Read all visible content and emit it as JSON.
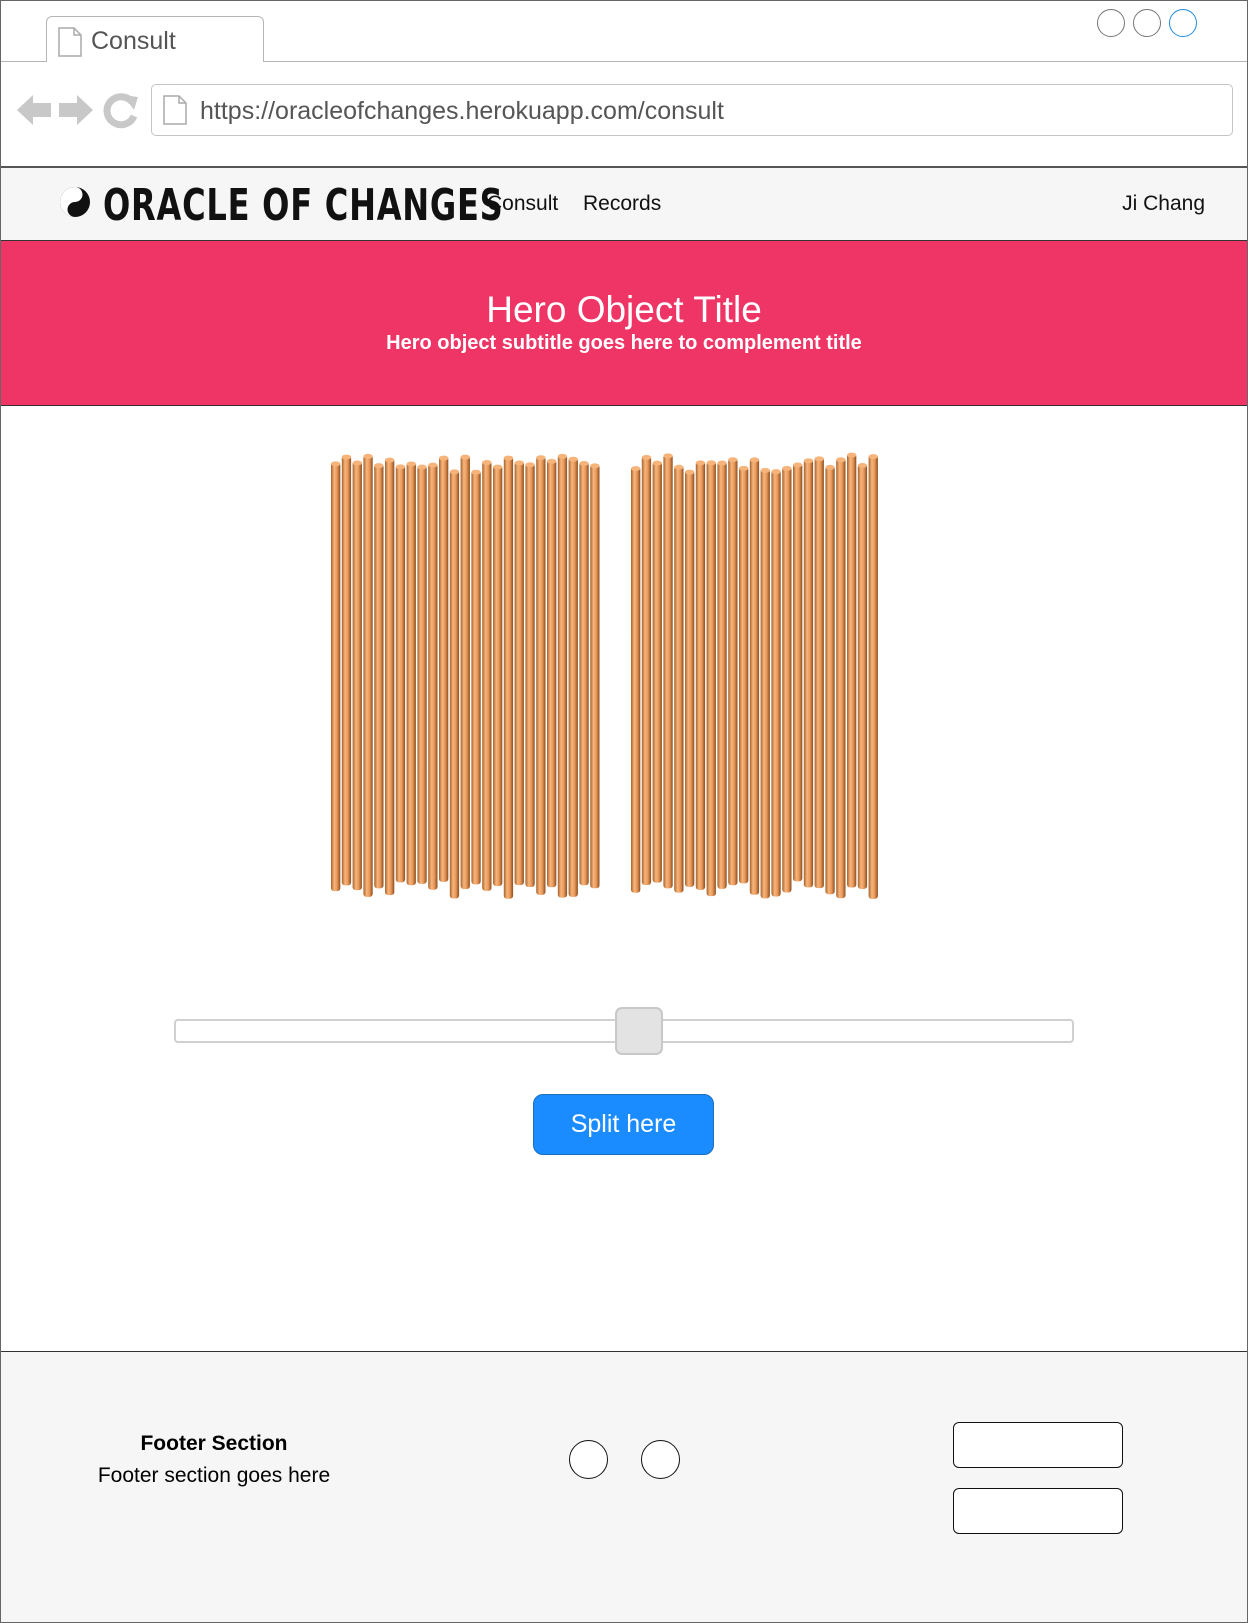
{
  "browser": {
    "tab_title": "Consult",
    "url": "https://oracleofchanges.herokuapp.com/consult",
    "window_controls": [
      "minimize",
      "maximize",
      "close"
    ],
    "nav_icons": [
      "back-arrow-icon",
      "forward-arrow-icon",
      "reload-icon"
    ]
  },
  "header": {
    "brand": "ORACLE OF CHANGES",
    "logo_icon": "yin-yang-icon",
    "nav": [
      "Consult",
      "Records"
    ],
    "user": "Ji Chang"
  },
  "hero": {
    "title": "Hero Object Title",
    "subtitle": "Hero object subtitle goes here to complement title",
    "background_color": "#ef3566"
  },
  "main": {
    "stick_color": "#f0a060",
    "split_button_label": "Split here",
    "split_button_color": "#1a8cff",
    "slider_position": 0.5
  },
  "footer": {
    "title": "Footer Section",
    "text": "Footer section goes here"
  }
}
